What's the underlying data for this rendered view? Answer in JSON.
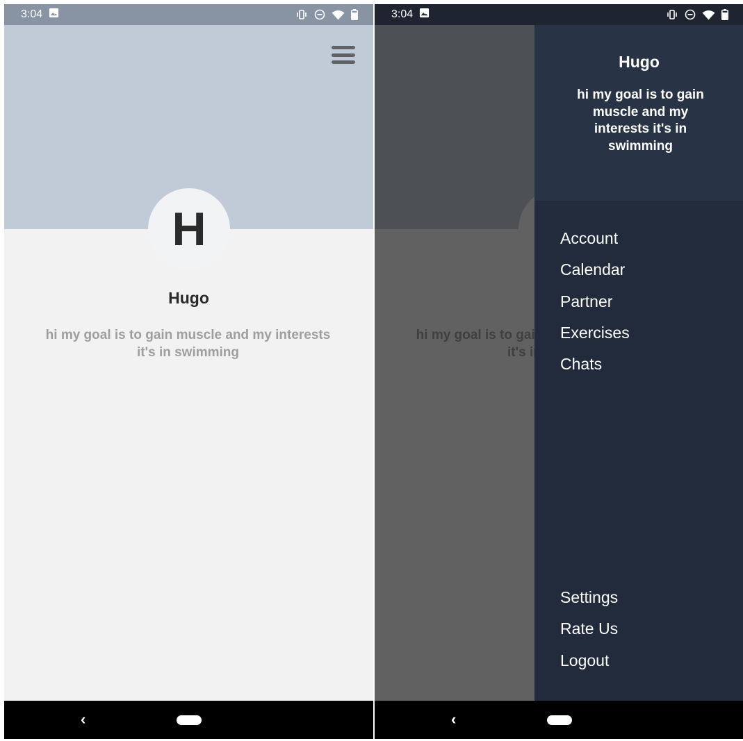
{
  "status_bar": {
    "time": "3:04"
  },
  "profile": {
    "initial": "H",
    "name": "Hugo",
    "bio": "hi my goal is to gain muscle and my interests it's in swimming"
  },
  "drawer": {
    "name": "Hugo",
    "bio": "hi my goal is to gain muscle and my interests it's in swimming",
    "menu": [
      "Account",
      "Calendar",
      "Partner",
      "Exercises",
      "Chats"
    ],
    "bottom_menu": [
      "Settings",
      "Rate Us",
      "Logout"
    ]
  },
  "nav": {
    "back_symbol": "‹"
  },
  "colors": {
    "header_bg": "#c1cbd8",
    "screen_bg": "#f2f2f2",
    "drawer_bg": "#212b3c",
    "drawer_header_bg": "#283345",
    "status_bar_left": "#8893a4",
    "status_bar_right": "#1e2531"
  }
}
